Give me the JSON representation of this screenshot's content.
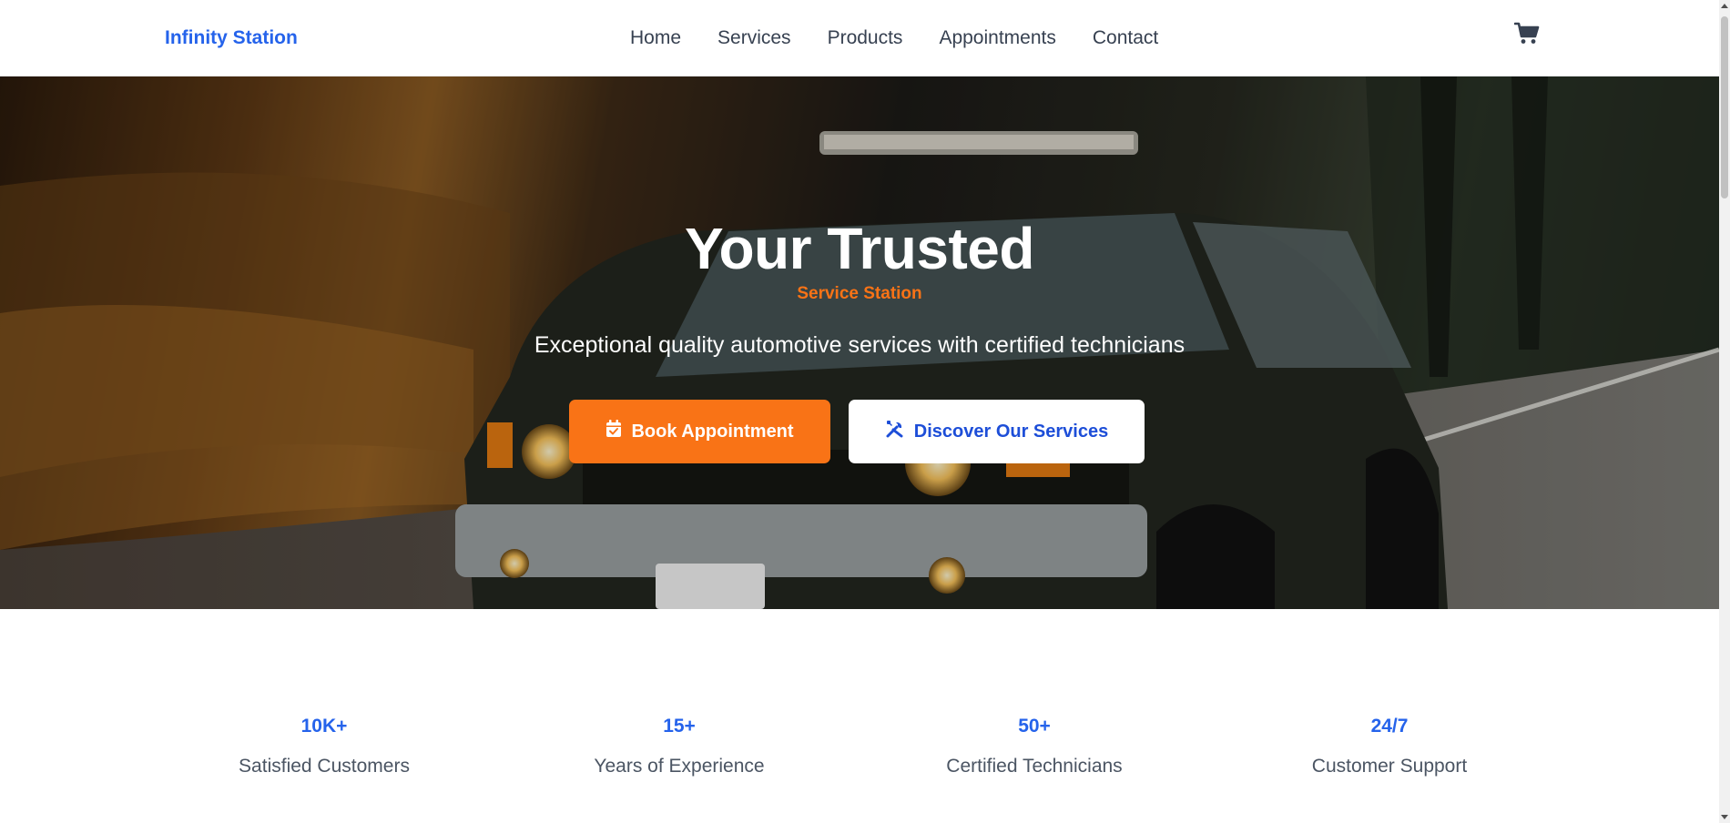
{
  "header": {
    "brand": "Infinity Station",
    "nav": [
      "Home",
      "Services",
      "Products",
      "Appointments",
      "Contact"
    ],
    "cart_icon": "shopping-cart-icon"
  },
  "hero": {
    "title": "Your Trusted",
    "subtitle": "Service Station",
    "tagline": "Exceptional quality automotive services with certified technicians",
    "primary_button": {
      "label": "Book Appointment",
      "icon": "calendar-check-icon"
    },
    "secondary_button": {
      "label": "Discover Our Services",
      "icon": "tools-icon"
    }
  },
  "stats": [
    {
      "value": "10K+",
      "label": "Satisfied Customers"
    },
    {
      "value": "15+",
      "label": "Years of Experience"
    },
    {
      "value": "50+",
      "label": "Certified Technicians"
    },
    {
      "value": "24/7",
      "label": "Customer Support"
    }
  ],
  "colors": {
    "brand_blue": "#2563eb",
    "accent_orange": "#f97316",
    "text_dark": "#374151",
    "text_muted": "#4b5563"
  }
}
